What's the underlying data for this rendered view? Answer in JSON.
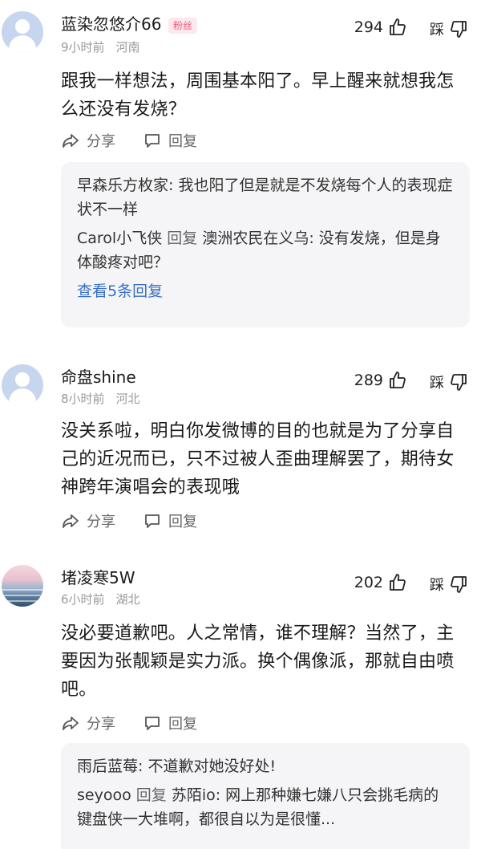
{
  "comments": [
    {
      "username": "蓝染忽悠介66",
      "badge": "粉丝",
      "time": "9小时前",
      "region": "河南",
      "likes": "294",
      "dislike_label": "踩",
      "text": "跟我一样想法，周围基本阳了。早上醒来就想我怎么还没有发烧？",
      "share_label": "分享",
      "reply_label": "回复",
      "replies": [
        {
          "user": "早森乐方枚家",
          "text": ": 我也阳了但是就是不发烧每个人的表现症状不一样"
        },
        {
          "user": "Carol小飞侠",
          "reply_word": " 回复 ",
          "target": "澳洲农民在义乌",
          "text": ": 没有发烧，但是身体酸疼对吧？"
        }
      ],
      "more_replies": "查看5条回复"
    },
    {
      "username": "命盘shine",
      "time": "8小时前",
      "region": "河北",
      "likes": "289",
      "dislike_label": "踩",
      "text": "没关系啦，明白你发微博的目的也就是为了分享自己的近况而已，只不过被人歪曲理解罢了，期待女神跨年演唱会的表现哦",
      "share_label": "分享",
      "reply_label": "回复"
    },
    {
      "username": "堵凌寒5W",
      "time": "6小时前",
      "region": "湖北",
      "likes": "202",
      "dislike_label": "踩",
      "text": "没必要道歉吧。人之常情，谁不理解？当然了，主要因为张靓颖是实力派。换个偶像派，那就自由喷吧。",
      "share_label": "分享",
      "reply_label": "回复",
      "replies": [
        {
          "user": "雨后蓝莓",
          "text": ": 不道歉对她没好处!"
        },
        {
          "user": "seyooo",
          "reply_word": " 回复 ",
          "target": "苏陌io",
          "text": ": 网上那种嫌七嫌八只会挑毛病的键盘侠一大堆啊，都很自以为是很懂..."
        }
      ]
    }
  ]
}
